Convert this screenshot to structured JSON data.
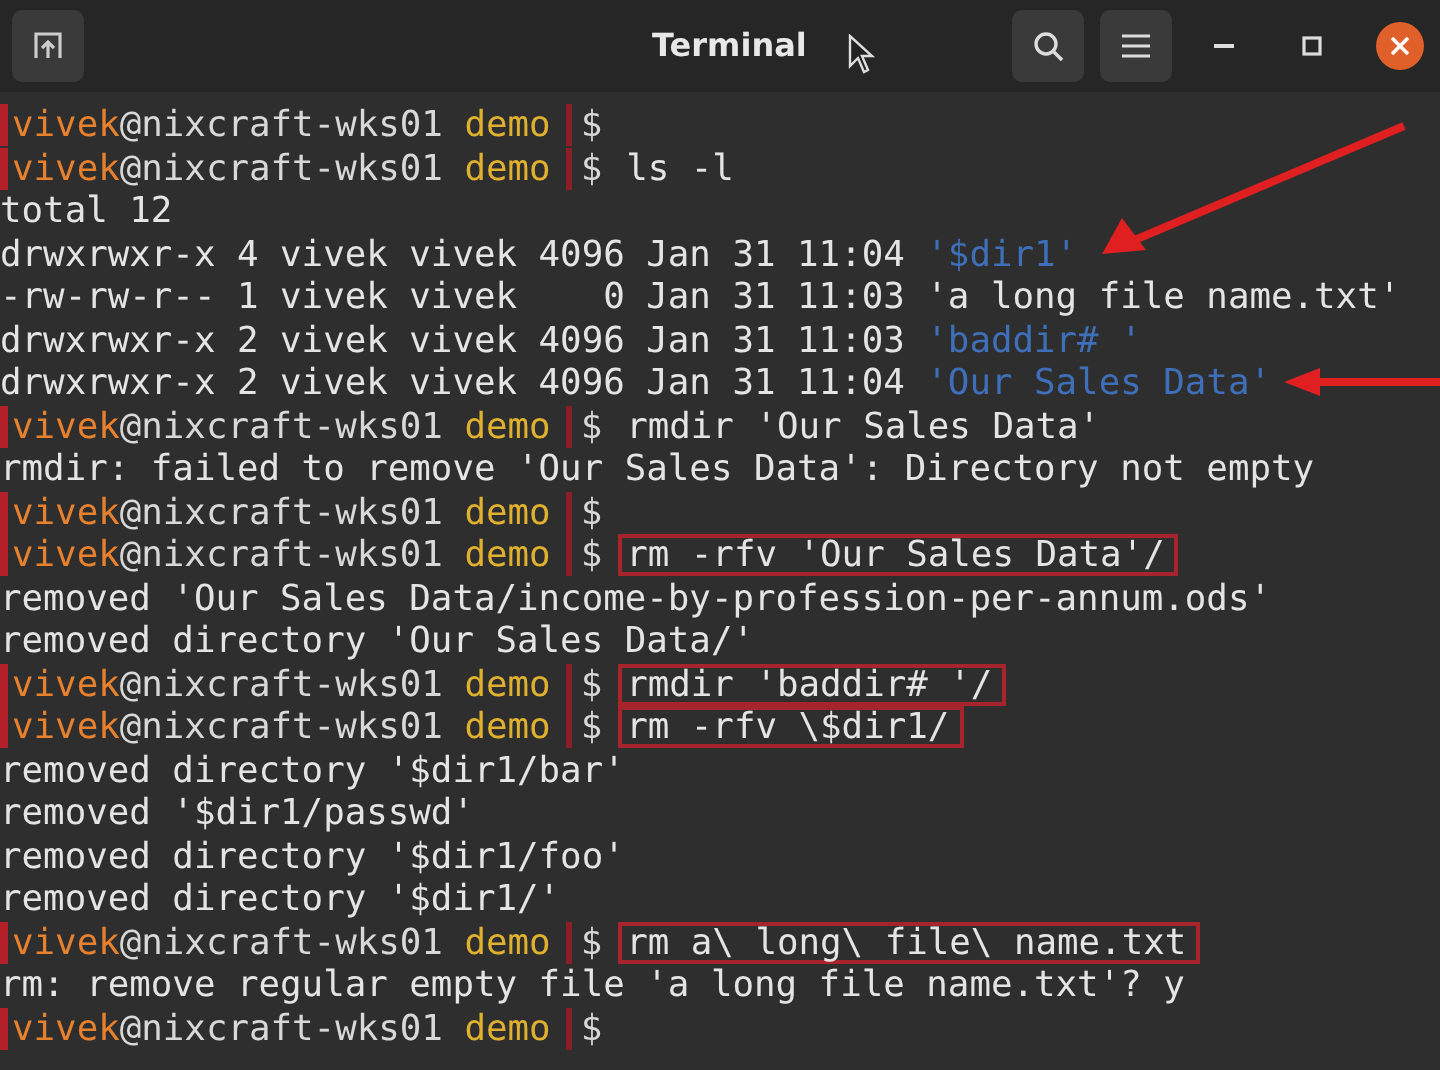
{
  "window": {
    "title": "Terminal"
  },
  "lines": [
    {
      "kind": "prompt",
      "user": "vivek",
      "host": "@nixcraft-wks01",
      "dir": "demo",
      "symbol": "$"
    },
    {
      "kind": "prompt",
      "user": "vivek",
      "host": "@nixcraft-wks01",
      "dir": "demo",
      "symbol": "$",
      "command": "ls -l",
      "boxed": false
    },
    {
      "kind": "output",
      "text": "total 12"
    },
    {
      "kind": "listing",
      "info": "drwxrwxr-x 4 vivek vivek 4096 Jan 31 11:04",
      "name": "'$dir1'",
      "directory": true,
      "arrow": {
        "kind": "diagonal"
      }
    },
    {
      "kind": "listing",
      "info": "-rw-rw-r-- 1 vivek vivek    0 Jan 31 11:03",
      "name": "'a long file name.txt'",
      "directory": false
    },
    {
      "kind": "listing",
      "info": "drwxrwxr-x 2 vivek vivek 4096 Jan 31 11:03",
      "name": "'baddir# '",
      "directory": true
    },
    {
      "kind": "listing",
      "info": "drwxrwxr-x 2 vivek vivek 4096 Jan 31 11:04",
      "name": "'Our Sales Data'",
      "directory": true,
      "arrow": {
        "kind": "straight"
      }
    },
    {
      "kind": "prompt",
      "user": "vivek",
      "host": "@nixcraft-wks01",
      "dir": "demo",
      "symbol": "$",
      "command": "rmdir 'Our Sales Data'",
      "boxed": false
    },
    {
      "kind": "output",
      "text": "rmdir: failed to remove 'Our Sales Data': Directory not empty"
    },
    {
      "kind": "prompt",
      "user": "vivek",
      "host": "@nixcraft-wks01",
      "dir": "demo",
      "symbol": "$"
    },
    {
      "kind": "prompt",
      "user": "vivek",
      "host": "@nixcraft-wks01",
      "dir": "demo",
      "symbol": "$",
      "command": "rm -rfv 'Our Sales Data'/",
      "boxed": true
    },
    {
      "kind": "output",
      "text": "removed 'Our Sales Data/income-by-profession-per-annum.ods'"
    },
    {
      "kind": "output",
      "text": "removed directory 'Our Sales Data/'"
    },
    {
      "kind": "prompt",
      "user": "vivek",
      "host": "@nixcraft-wks01",
      "dir": "demo",
      "symbol": "$",
      "command": "rmdir 'baddir# '/",
      "boxed": true
    },
    {
      "kind": "prompt",
      "user": "vivek",
      "host": "@nixcraft-wks01",
      "dir": "demo",
      "symbol": "$",
      "command": "rm -rfv \\$dir1/",
      "boxed": true
    },
    {
      "kind": "output",
      "text": "removed directory '$dir1/bar'"
    },
    {
      "kind": "output",
      "text": "removed '$dir1/passwd'"
    },
    {
      "kind": "output",
      "text": "removed directory '$dir1/foo'"
    },
    {
      "kind": "output",
      "text": "removed directory '$dir1/'"
    },
    {
      "kind": "prompt",
      "user": "vivek",
      "host": "@nixcraft-wks01",
      "dir": "demo",
      "symbol": "$",
      "command": "rm a\\ long\\ file\\ name.txt",
      "boxed": true
    },
    {
      "kind": "output",
      "text": "rm: remove regular empty file 'a long file name.txt'? y"
    },
    {
      "kind": "prompt",
      "user": "vivek",
      "host": "@nixcraft-wks01",
      "dir": "demo",
      "symbol": "$"
    }
  ]
}
